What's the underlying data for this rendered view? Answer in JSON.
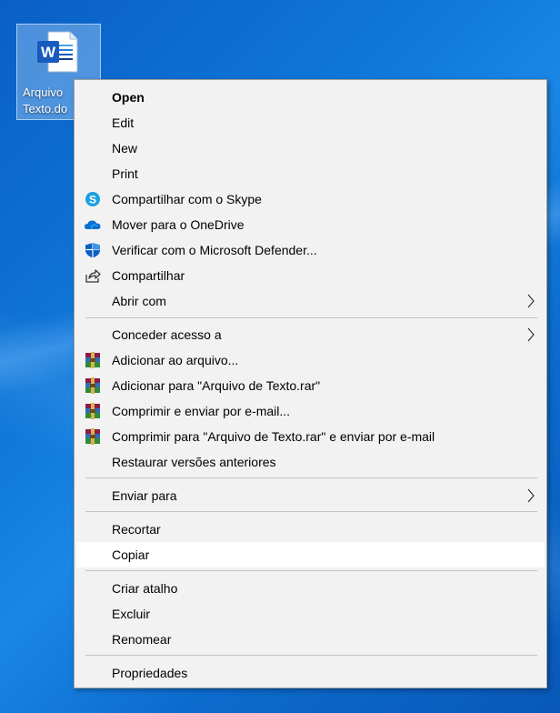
{
  "desktop": {
    "icon_label_line1": "Arquivo",
    "icon_label_line2": "Texto.do",
    "icon_name": "word-document-icon"
  },
  "context_menu": {
    "items": [
      {
        "label": "Open",
        "icon": null,
        "bold": true
      },
      {
        "label": "Edit",
        "icon": null
      },
      {
        "label": "New",
        "icon": null
      },
      {
        "label": "Print",
        "icon": null
      },
      {
        "label": "Compartilhar com o Skype",
        "icon": "skype-icon"
      },
      {
        "label": "Mover para o OneDrive",
        "icon": "onedrive-icon"
      },
      {
        "label": "Verificar com o Microsoft Defender...",
        "icon": "defender-shield-icon"
      },
      {
        "label": "Compartilhar",
        "icon": "share-icon"
      },
      {
        "label": "Abrir com",
        "icon": null,
        "submenu": true
      },
      {
        "label": "Conceder acesso a",
        "icon": null,
        "submenu": true
      },
      {
        "label": "Adicionar ao arquivo...",
        "icon": "winrar-icon"
      },
      {
        "label": "Adicionar para \"Arquivo de Texto.rar\"",
        "icon": "winrar-icon"
      },
      {
        "label": "Comprimir e enviar por e-mail...",
        "icon": "winrar-icon"
      },
      {
        "label": "Comprimir para \"Arquivo de Texto.rar\" e enviar por e-mail",
        "icon": "winrar-icon"
      },
      {
        "label": "Restaurar versões anteriores",
        "icon": null
      },
      {
        "label": "Enviar para",
        "icon": null,
        "submenu": true
      },
      {
        "label": "Recortar",
        "icon": null
      },
      {
        "label": "Copiar",
        "icon": null,
        "highlighted": true
      },
      {
        "label": "Criar atalho",
        "icon": null
      },
      {
        "label": "Excluir",
        "icon": null
      },
      {
        "label": "Renomear",
        "icon": null
      },
      {
        "label": "Propriedades",
        "icon": null
      }
    ]
  },
  "colors": {
    "desktop_blue": "#0f78d8",
    "menu_bg": "#f2f2f2",
    "highlight": "#ffffff",
    "word_blue": "#185abd"
  }
}
